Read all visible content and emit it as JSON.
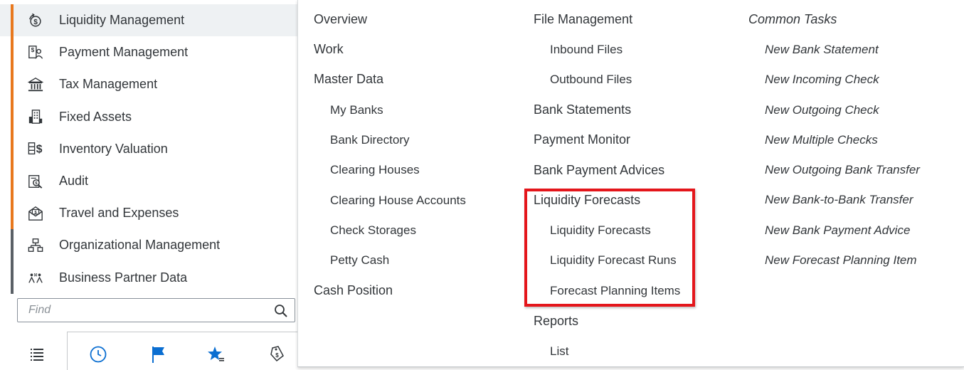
{
  "sidebar": {
    "items": [
      {
        "label": "Liquidity Management",
        "icon": "liquidity-icon"
      },
      {
        "label": "Payment Management",
        "icon": "payment-icon"
      },
      {
        "label": "Tax Management",
        "icon": "bank-building-icon"
      },
      {
        "label": "Fixed Assets",
        "icon": "fixed-assets-icon"
      },
      {
        "label": "Inventory Valuation",
        "icon": "inventory-icon"
      },
      {
        "label": "Audit",
        "icon": "audit-icon"
      },
      {
        "label": "Travel and Expenses",
        "icon": "travel-icon"
      },
      {
        "label": "Organizational Management",
        "icon": "org-chart-icon"
      },
      {
        "label": "Business Partner Data",
        "icon": "business-partner-icon"
      }
    ],
    "find": {
      "placeholder": "Find"
    }
  },
  "toolbar": {
    "icons": [
      "list-icon",
      "clock-icon",
      "flag-icon",
      "favorite-star-icon",
      "tag-icon"
    ]
  },
  "menu": {
    "col1": [
      {
        "label": "Overview",
        "level": 0
      },
      {
        "label": "Work",
        "level": 0
      },
      {
        "label": "Master Data",
        "level": 0
      },
      {
        "label": "My Banks",
        "level": 1
      },
      {
        "label": "Bank Directory",
        "level": 1
      },
      {
        "label": "Clearing Houses",
        "level": 1
      },
      {
        "label": "Clearing House Accounts",
        "level": 1
      },
      {
        "label": "Check Storages",
        "level": 1
      },
      {
        "label": "Petty Cash",
        "level": 1
      },
      {
        "label": "Cash Position",
        "level": 0
      }
    ],
    "col2": [
      {
        "label": "File Management",
        "level": 0
      },
      {
        "label": "Inbound Files",
        "level": 1
      },
      {
        "label": "Outbound Files",
        "level": 1
      },
      {
        "label": "Bank Statements",
        "level": 0
      },
      {
        "label": "Payment Monitor",
        "level": 0
      },
      {
        "label": "Bank Payment Advices",
        "level": 0
      },
      {
        "label": "Liquidity Forecasts",
        "level": 0
      },
      {
        "label": "Liquidity Forecasts",
        "level": 1
      },
      {
        "label": "Liquidity Forecast Runs",
        "level": 1
      },
      {
        "label": "Forecast Planning Items",
        "level": 1
      },
      {
        "label": "Reports",
        "level": 0
      },
      {
        "label": "List",
        "level": 1
      }
    ],
    "col3_header": "Common Tasks",
    "col3": [
      "New Bank Statement",
      "New Incoming Check",
      "New Outgoing Check",
      "New Multiple Checks",
      "New Outgoing Bank Transfer",
      "New Bank-to-Bank Transfer",
      "New Bank Payment Advice",
      "New Forecast Planning Item"
    ]
  },
  "colors": {
    "accent_bar": "#e8781e",
    "accent_bar_dark": "#5a6066",
    "highlight": "#e4161b",
    "active_row": "#eef1f3"
  }
}
